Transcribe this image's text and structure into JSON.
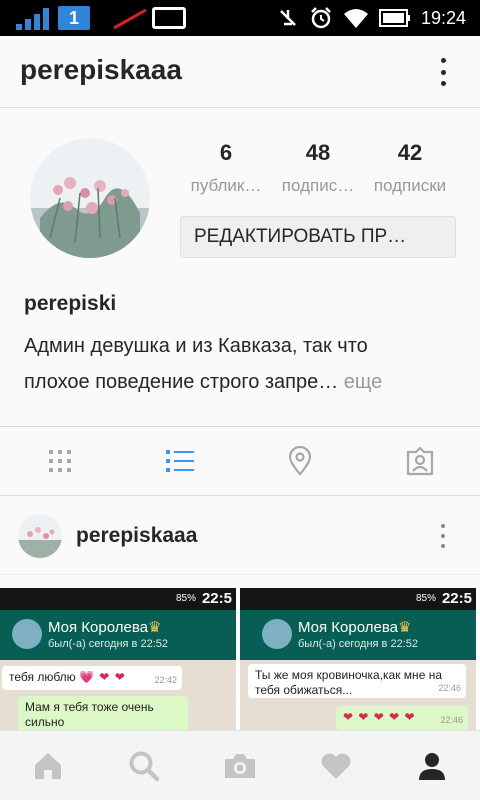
{
  "status_bar": {
    "sim_number": "1",
    "time": "19:24"
  },
  "header": {
    "title": "perepiskaaa"
  },
  "profile": {
    "stats": [
      {
        "value": "6",
        "label": "публик…"
      },
      {
        "value": "48",
        "label": "подпис…"
      },
      {
        "value": "42",
        "label": "подписки"
      }
    ],
    "edit_button_label": "РЕДАКТИРОВАТЬ ПР…",
    "name": "perepiski",
    "bio_line1": "Админ девушка и из Кавказа, так что",
    "bio_line2": "плохое поведение строго запре…",
    "bio_more": " еще"
  },
  "view_tabs": [
    {
      "icon": "grid-icon",
      "active": false
    },
    {
      "icon": "list-icon",
      "active": true
    },
    {
      "icon": "location-pin-icon",
      "active": false
    },
    {
      "icon": "tagged-photos-icon",
      "active": false
    }
  ],
  "post": {
    "username": "perepiskaaa",
    "left_screenshot": {
      "battery": "85%",
      "time": "22:5",
      "contact": "Моя Королева",
      "last_seen": "был(-а) сегодня в 22:52",
      "msg1": "тебя люблю",
      "msg1_time": "22:42",
      "msg2": "Мам я тебя тоже очень сильно"
    },
    "right_screenshot": {
      "battery": "85%",
      "time": "22:5",
      "contact": "Моя Королева",
      "last_seen": "был(-а) сегодня в 22:52",
      "msg1": "Ты же моя кровиночка,как мне на тебя обижаться...",
      "msg1_time": "22:46",
      "msg2_time": "22:46"
    }
  },
  "bottom_nav": [
    {
      "icon": "home-icon"
    },
    {
      "icon": "search-icon"
    },
    {
      "icon": "camera-icon"
    },
    {
      "icon": "heart-icon"
    },
    {
      "icon": "profile-icon",
      "active": true
    }
  ],
  "colors": {
    "accent_blue": "#3897f0",
    "whatsapp_green": "#075e54",
    "sim_blue": "#2f86d8"
  }
}
